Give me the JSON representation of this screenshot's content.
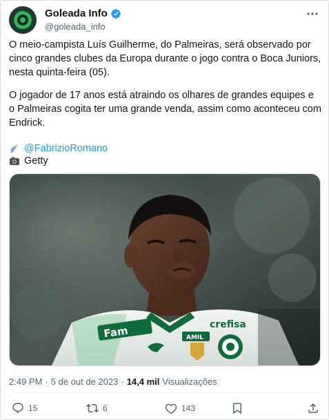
{
  "author": {
    "display_name": "Goleada Info",
    "handle": "@goleada_info",
    "verified": true
  },
  "tweet": {
    "paragraphs": [
      "O meio-campista Luís Guilherme, do Palmeiras, será observado por cinco grandes clubes da Europa durante o jogo contra o Boca Juniors, nesta quinta-feira (05).",
      "O jogador de 17 anos está atraindo os olhares de grandes equipes e o Palmeiras cogita ter uma grande venda, assim como aconteceu com Endrick."
    ],
    "source_credit": "@FabrizioRomano",
    "photo_credit": "Getty",
    "icons": {
      "source": "satellite-antenna-icon",
      "photo": "camera-flash-icon"
    }
  },
  "media": {
    "jersey_texts": [
      "Fam",
      "crefisa",
      "AMIL"
    ]
  },
  "meta": {
    "time": "2:49 PM",
    "separator": "·",
    "date": "5 de out de 2023",
    "views_count": "14,4 mil",
    "views_label": "Visualizações"
  },
  "actions": {
    "replies": "15",
    "retweets": "6",
    "likes": "143"
  },
  "colors": {
    "accent": "#1d9bf0",
    "text": "#0f1419",
    "secondary": "#536471",
    "verified": "#1d9bf0"
  }
}
